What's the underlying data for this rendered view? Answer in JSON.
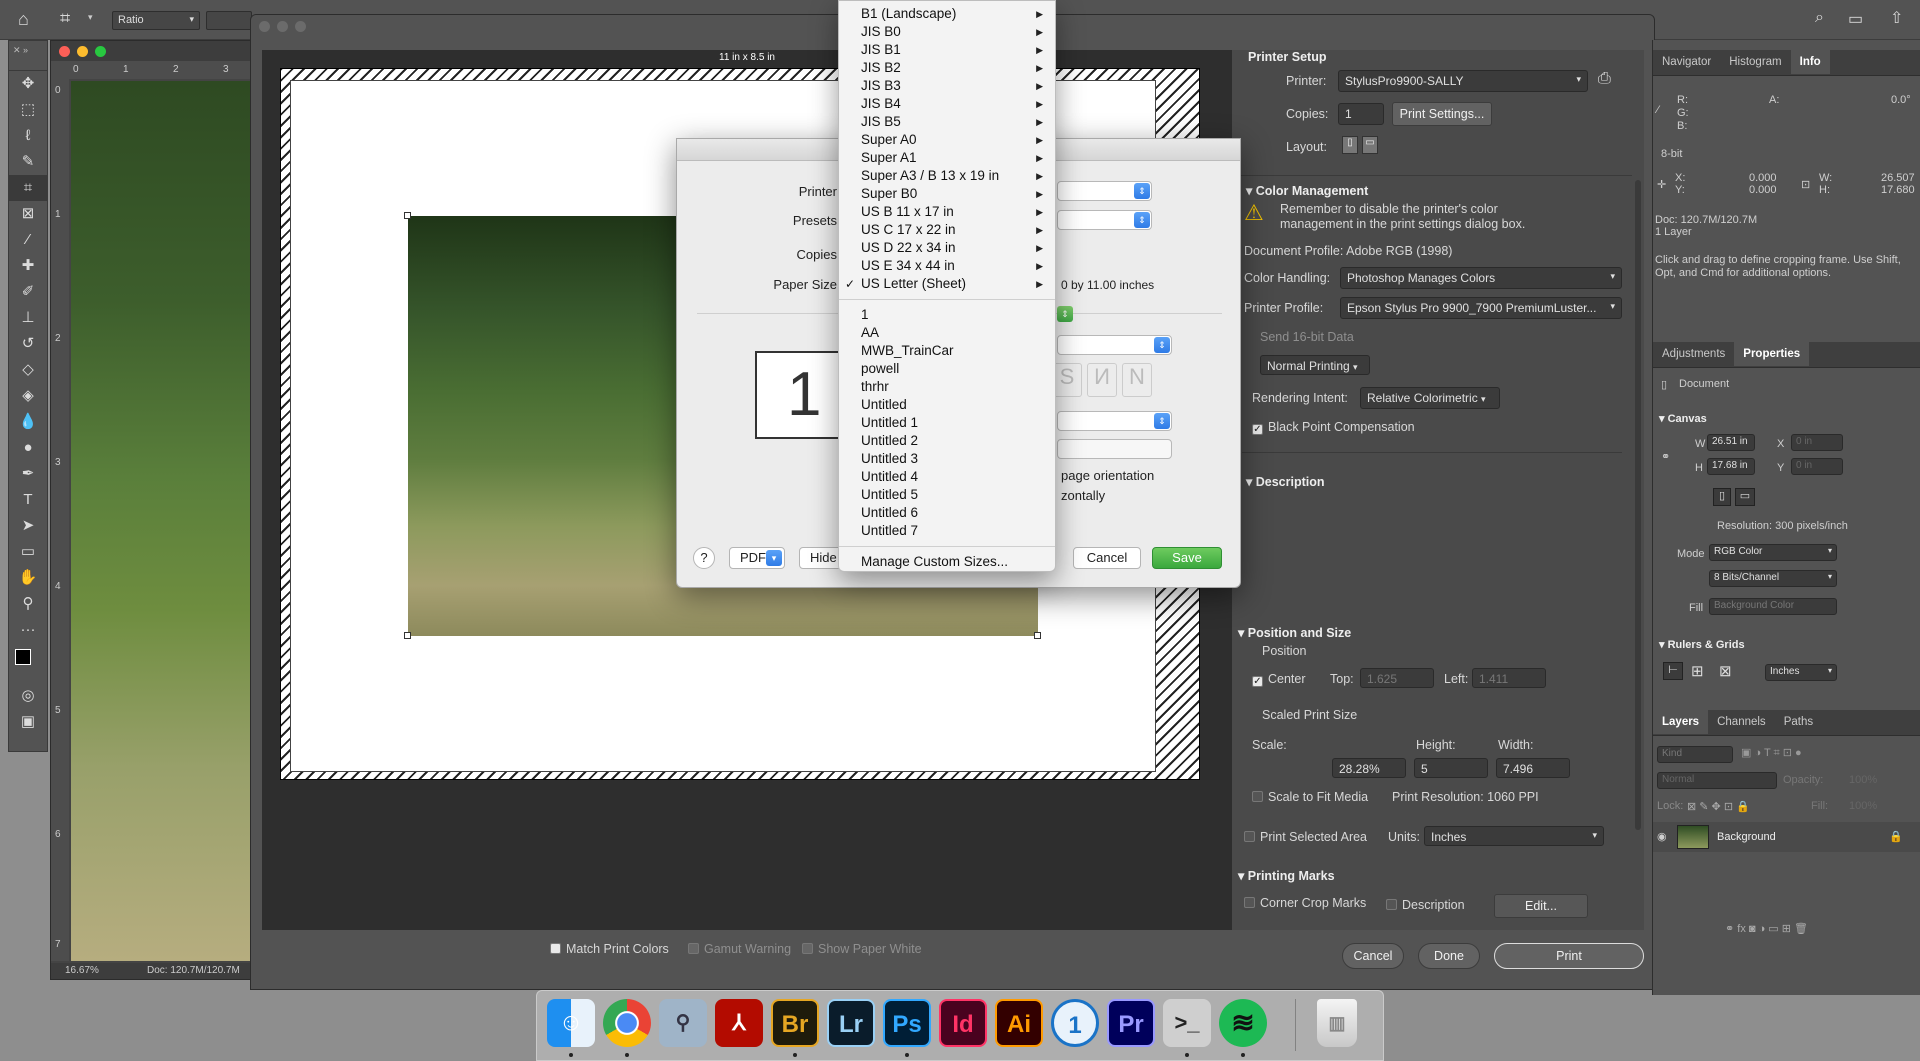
{
  "optbar": {
    "ratio_label": "Ratio"
  },
  "doc": {
    "zoom": "16.67%",
    "status": "Doc: 120.7M/120.7M",
    "ruler": [
      "0",
      "1",
      "2",
      "3"
    ],
    "vruler": [
      "0",
      "1",
      "2",
      "3",
      "4",
      "5",
      "6",
      "7"
    ]
  },
  "print": {
    "size_label": "11 in x 8.5 in",
    "setup_title": "Printer Setup",
    "printer_label": "Printer:",
    "printer_value": "StylusPro9900-SALLY",
    "copies_label": "Copies:",
    "copies_value": "1",
    "print_settings": "Print Settings...",
    "layout_label": "Layout:",
    "cm_title": "Color Management",
    "cm_note": "Remember to disable the printer's color management in the print settings dialog box.",
    "doc_profile": "Document Profile: Adobe RGB (1998)",
    "color_handling_label": "Color Handling:",
    "color_handling": "Photoshop Manages Colors",
    "printer_profile_label": "Printer Profile:",
    "printer_profile": "Epson Stylus Pro 9900_7900 PremiumLuster...",
    "send16": "Send 16-bit Data",
    "normal_printing": "Normal Printing",
    "rendering_label": "Rendering Intent:",
    "rendering": "Relative Colorimetric",
    "bpc": "Black Point Compensation",
    "description_title": "Description",
    "pos_title": "Position and Size",
    "position": "Position",
    "center": "Center",
    "top_label": "Top:",
    "top_value": "1.625",
    "left_label": "Left:",
    "left_value": "1.411",
    "scaled": "Scaled Print Size",
    "scale_label": "Scale:",
    "height_label": "Height:",
    "width_label": "Width:",
    "scale": "28.28%",
    "height": "5",
    "width": "7.496",
    "fit": "Scale to Fit Media",
    "resolution": "Print Resolution: 1060 PPI",
    "psa": "Print Selected Area",
    "units_label": "Units:",
    "units": "Inches",
    "marks_title": "Printing Marks",
    "corner": "Corner Crop Marks",
    "desc_chk": "Description",
    "edit": "Edit...",
    "match": "Match Print Colors",
    "gamut": "Gamut Warning",
    "paper_white": "Show Paper White",
    "cancel": "Cancel",
    "done": "Done",
    "print_btn": "Print"
  },
  "info": {
    "tabs": [
      "Navigator",
      "Histogram",
      "Info"
    ],
    "r": "R:",
    "g": "G:",
    "b": "B:",
    "a": "A:",
    "a_val": "0.0°",
    "bit": "8-bit",
    "x": "X:",
    "y": "Y:",
    "xv": "0.000",
    "yv": "0.000",
    "w": "W:",
    "h": "H:",
    "wv": "26.507",
    "hv": "17.680",
    "doc": "Doc: 120.7M/120.7M",
    "layer": "1 Layer",
    "hint": "Click and drag to define cropping frame. Use Shift, Opt, and Cmd for additional options."
  },
  "props": {
    "tabs": [
      "Adjustments",
      "Properties"
    ],
    "document": "Document",
    "canvas": "Canvas",
    "w": "W",
    "h": "H",
    "wv": "26.51 in",
    "hv": "17.68 in",
    "x": "X",
    "y": "Y",
    "xph": "0 in",
    "yph": "0 in",
    "resolution": "Resolution: 300 pixels/inch",
    "mode_label": "Mode",
    "mode": "RGB Color",
    "bits": "8 Bits/Channel",
    "fill": "Fill",
    "fill_val": "Background Color",
    "rulers": "Rulers & Grids",
    "units": "Inches"
  },
  "layers": {
    "tabs": [
      "Layers",
      "Channels",
      "Paths"
    ],
    "kind": "Kind",
    "normal": "Normal",
    "opacity": "Opacity:",
    "opacity_v": "100%",
    "lock": "Lock:",
    "fill": "Fill:",
    "fill_v": "100%",
    "bg": "Background"
  },
  "sheet": {
    "printer": "Printer",
    "presets": "Presets",
    "copies": "Copies",
    "paper": "Paper Size",
    "paper_dims": "0 by 11.00 inches",
    "page_num": "1",
    "orient": "page orientation",
    "horiz": "zontally",
    "help": "?",
    "pdf": "PDF",
    "hide": "Hide",
    "cancel": "Cancel",
    "save": "Save"
  },
  "menu": {
    "items": [
      "B1 (Landscape)",
      "JIS B0",
      "JIS B1",
      "JIS B2",
      "JIS B3",
      "JIS B4",
      "JIS B5",
      "Super A0",
      "Super A1",
      "Super A3 / B 13 x 19 in",
      "Super B0",
      "US B 11 x 17 in",
      "US C 17 x 22 in",
      "US D 22 x 34 in",
      "US E 34 x 44 in",
      "US Letter (Sheet)"
    ],
    "checked": "✓",
    "custom": [
      "1",
      "AA",
      "MWB_TrainCar",
      "powell",
      "thrhr",
      "Untitled",
      "Untitled 1",
      "Untitled 2",
      "Untitled 3",
      "Untitled 4",
      "Untitled 5",
      "Untitled 6",
      "Untitled 7"
    ],
    "manage": "Manage Custom Sizes..."
  },
  "dock": {
    "apps": [
      "Finder",
      "Chrome",
      "Preview",
      "Acrobat",
      "Br",
      "Lr",
      "Ps",
      "Id",
      "Ai",
      "1Password",
      "Pr",
      "Terminal",
      "Spotify",
      "Trash"
    ]
  }
}
